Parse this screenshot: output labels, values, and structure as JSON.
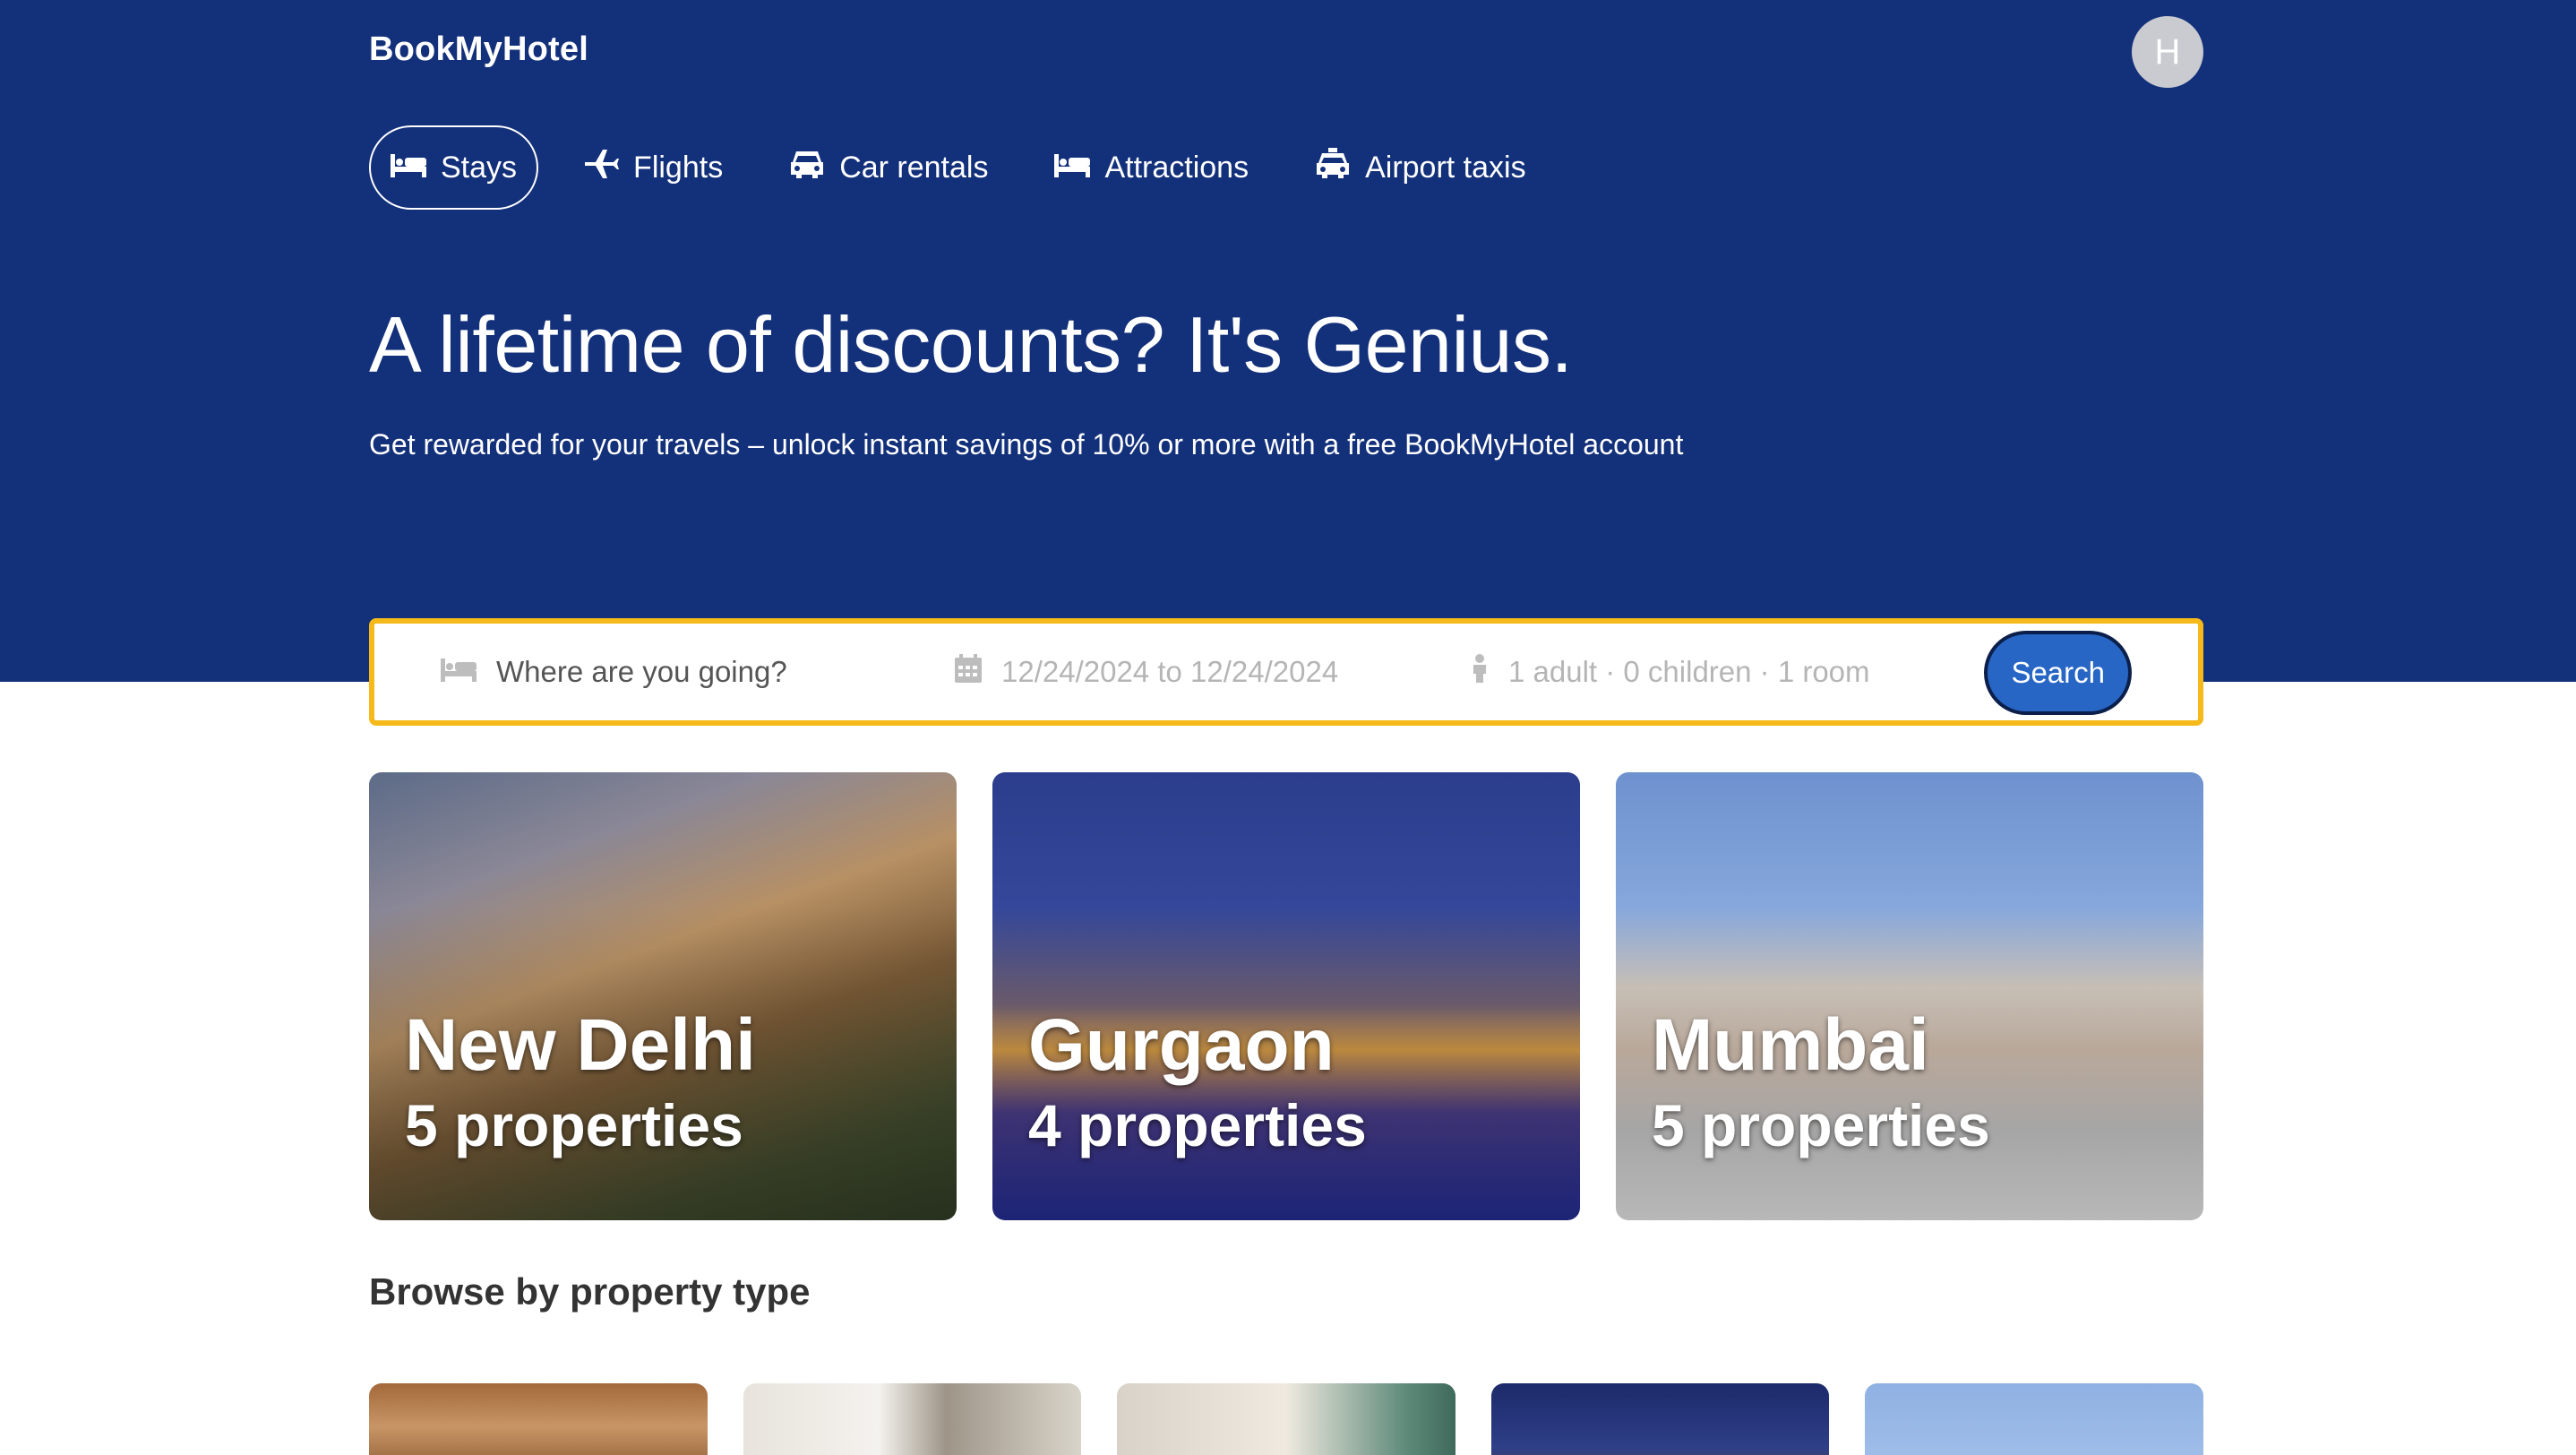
{
  "brand": {
    "name": "BookMyHotel"
  },
  "user": {
    "avatar_initial": "H"
  },
  "nav": {
    "tabs": [
      {
        "label": "Stays",
        "icon": "bed-icon",
        "active": true
      },
      {
        "label": "Flights",
        "icon": "plane-icon",
        "active": false
      },
      {
        "label": "Car rentals",
        "icon": "car-icon",
        "active": false
      },
      {
        "label": "Attractions",
        "icon": "bed-icon",
        "active": false
      },
      {
        "label": "Airport taxis",
        "icon": "taxi-icon",
        "active": false
      }
    ]
  },
  "hero": {
    "headline": "A lifetime of discounts? It's Genius.",
    "subhead": "Get rewarded for your travels – unlock instant savings of 10% or more with a free BookMyHotel account"
  },
  "search": {
    "destination_placeholder": "Where are you going?",
    "dates": "12/24/2024 to 12/24/2024",
    "guests": "1 adult · 0 children · 1 room",
    "button_label": "Search"
  },
  "destinations": [
    {
      "city": "New Delhi",
      "properties": "5 properties"
    },
    {
      "city": "Gurgaon",
      "properties": "4 properties"
    },
    {
      "city": "Mumbai",
      "properties": "5 properties"
    }
  ],
  "property_types": {
    "title": "Browse by property type",
    "count": 5
  },
  "colors": {
    "hero_background": "#13307a",
    "search_border": "#f5b91a",
    "search_button": "#2766c5"
  }
}
